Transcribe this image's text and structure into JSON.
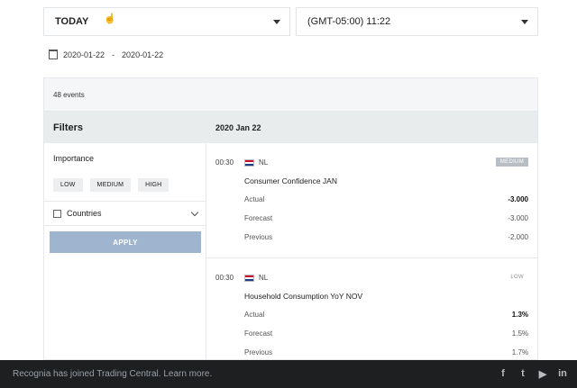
{
  "header": {
    "period_select": "TODAY",
    "timezone_select": "(GMT-05:00) 11:22"
  },
  "date_range": {
    "from": "2020-01-22",
    "separator": "-",
    "to": "2020-01-22"
  },
  "summary": {
    "events_count": "48 events"
  },
  "filters": {
    "title": "Filters",
    "importance_label": "Importance",
    "chips": [
      "LOW",
      "MEDIUM",
      "HIGH"
    ],
    "countries_label": "Countries",
    "apply_label": "APPLY"
  },
  "calendar": {
    "date_heading": "2020 Jan 22",
    "events": [
      {
        "time": "00:30",
        "country": "NL",
        "importance": "MEDIUM",
        "title": "Consumer Confidence JAN",
        "rows": [
          {
            "label": "Actual",
            "value": "-3.000"
          },
          {
            "label": "Forecast",
            "value": "-3.000"
          },
          {
            "label": "Previous",
            "value": "-2.000"
          }
        ]
      },
      {
        "time": "00:30",
        "country": "NL",
        "importance": "LOW",
        "title": "Household Consumption YoY NOV",
        "rows": [
          {
            "label": "Actual",
            "value": "1.3%"
          },
          {
            "label": "Forecast",
            "value": "1.5%"
          },
          {
            "label": "Previous",
            "value": "1.7%"
          }
        ]
      }
    ]
  },
  "footer": {
    "text": "Recognia has joined Trading Central. Learn more.",
    "social_icons": [
      "f",
      "t",
      "▶",
      "in"
    ]
  },
  "colors": {
    "apply_button": "#9fb4cf",
    "footer_bg": "#1d1f21",
    "header_band": "#e8eced"
  }
}
